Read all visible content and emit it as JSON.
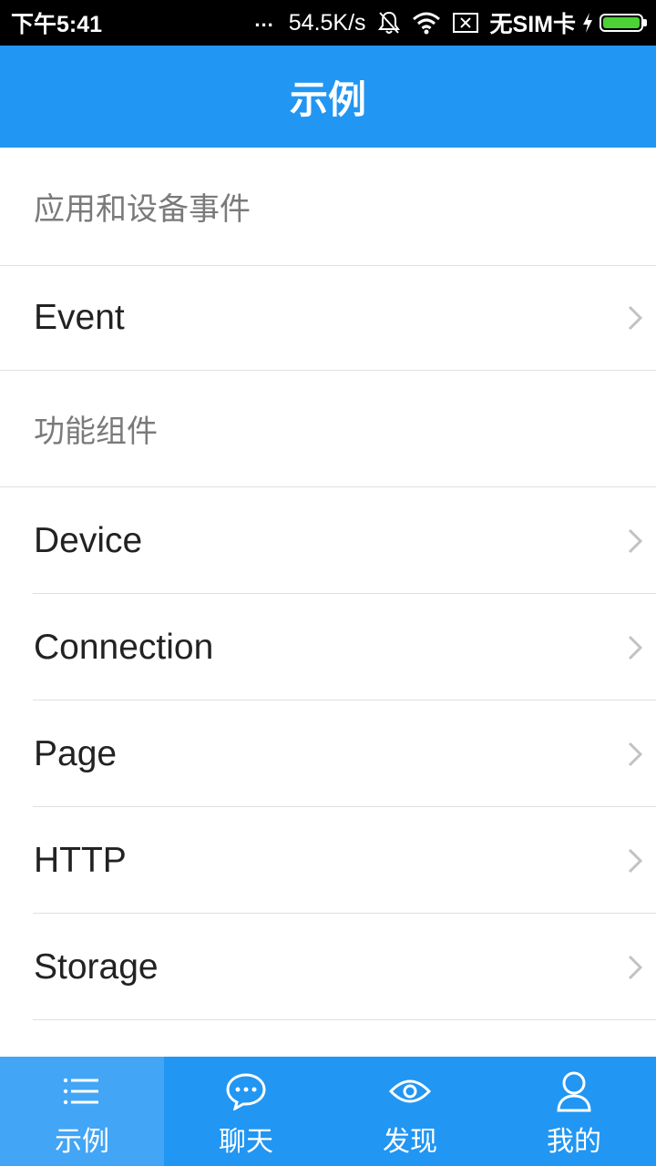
{
  "status_bar": {
    "time": "下午5:41",
    "dots": "...",
    "network_speed": "54.5K/s",
    "sim_text": "无SIM卡",
    "icons": [
      "mute-bell-icon",
      "wifi-icon",
      "no-sim-icon",
      "charging-bolt-icon",
      "battery-icon"
    ],
    "battery_color": "#4cd137"
  },
  "header": {
    "title": "示例"
  },
  "sections": [
    {
      "header": "应用和设备事件",
      "items": [
        "Event"
      ]
    },
    {
      "header": "功能组件",
      "items": [
        "Device",
        "Connection",
        "Page",
        "HTTP",
        "Storage"
      ]
    }
  ],
  "tabs": [
    {
      "label": "示例",
      "icon": "list-icon",
      "active": true
    },
    {
      "label": "聊天",
      "icon": "chat-bubble-icon",
      "active": false
    },
    {
      "label": "发现",
      "icon": "eye-icon",
      "active": false
    },
    {
      "label": "我的",
      "icon": "user-icon",
      "active": false
    }
  ],
  "colors": {
    "primary": "#2196f3",
    "active_tab": "#42a5f5",
    "section_header_text": "#7a7a7a",
    "item_text": "#222222",
    "divider": "#e0e0e0",
    "chevron": "#c2c2c2"
  }
}
